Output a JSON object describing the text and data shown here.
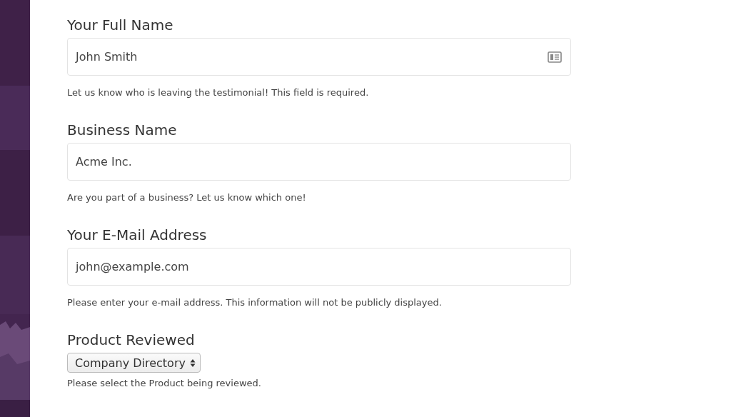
{
  "fields": [
    {
      "kind": "text",
      "label": "Your Full Name",
      "value": "John Smith",
      "card_icon": true,
      "help": "Let us know who is leaving the testimonial! This field is required."
    },
    {
      "kind": "text",
      "label": "Business Name",
      "value": "Acme Inc.",
      "card_icon": false,
      "help": "Are you part of a business? Let us know which one!"
    },
    {
      "kind": "text",
      "label": "Your E-Mail Address",
      "value": "john@example.com",
      "card_icon": false,
      "help": "Please enter your e-mail address. This information will not be publicly displayed."
    },
    {
      "kind": "select",
      "label": "Product Reviewed",
      "value": "Company Directory",
      "help": "Please select the Product being reviewed."
    }
  ]
}
